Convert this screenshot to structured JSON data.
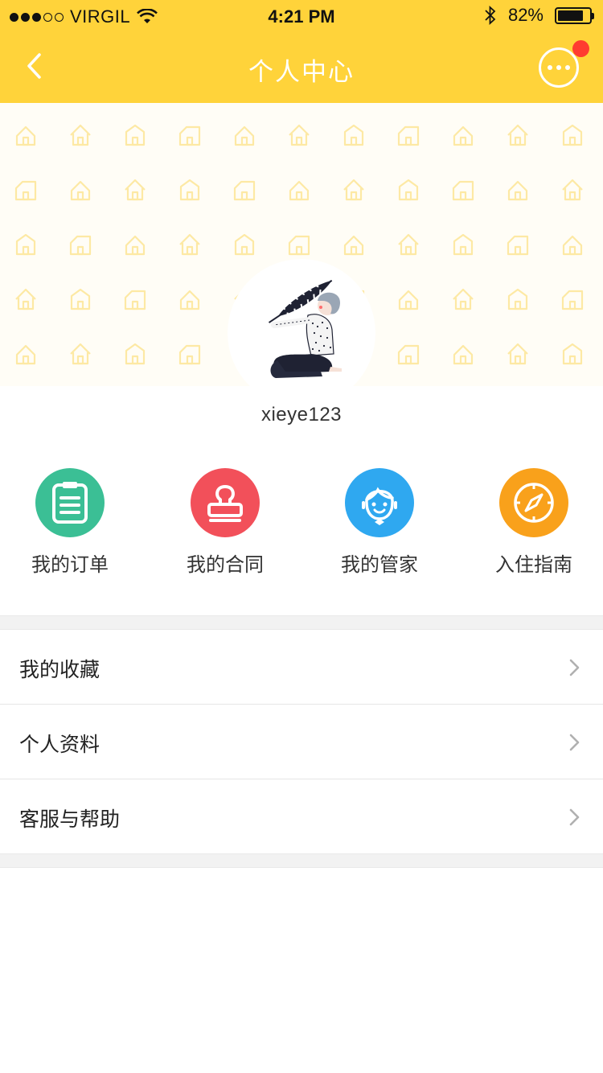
{
  "status_bar": {
    "carrier": "VIRGIL",
    "time": "4:21 PM",
    "battery": "82%",
    "battery_level": 0.82,
    "signal_bars_filled": 3,
    "signal_bars_total": 5
  },
  "nav": {
    "title": "个人中心",
    "back_icon": "chevron-left-icon",
    "more_icon": "more-horizontal-icon",
    "has_notification": true
  },
  "profile": {
    "username": "xieye123"
  },
  "quick_actions": [
    {
      "label": "我的订单",
      "icon": "clipboard-icon",
      "color": "#3bbf95"
    },
    {
      "label": "我的合同",
      "icon": "stamp-icon",
      "color": "#f2505a"
    },
    {
      "label": "我的管家",
      "icon": "butler-face-icon",
      "color": "#2fa8f0"
    },
    {
      "label": "入住指南",
      "icon": "compass-icon",
      "color": "#f9a11b"
    }
  ],
  "menu": [
    {
      "label": "我的收藏"
    },
    {
      "label": "个人资料"
    },
    {
      "label": "客服与帮助"
    }
  ],
  "colors": {
    "brand_yellow": "#ffd33a",
    "notification": "#ff3b30",
    "pattern": "#fde9a4"
  }
}
